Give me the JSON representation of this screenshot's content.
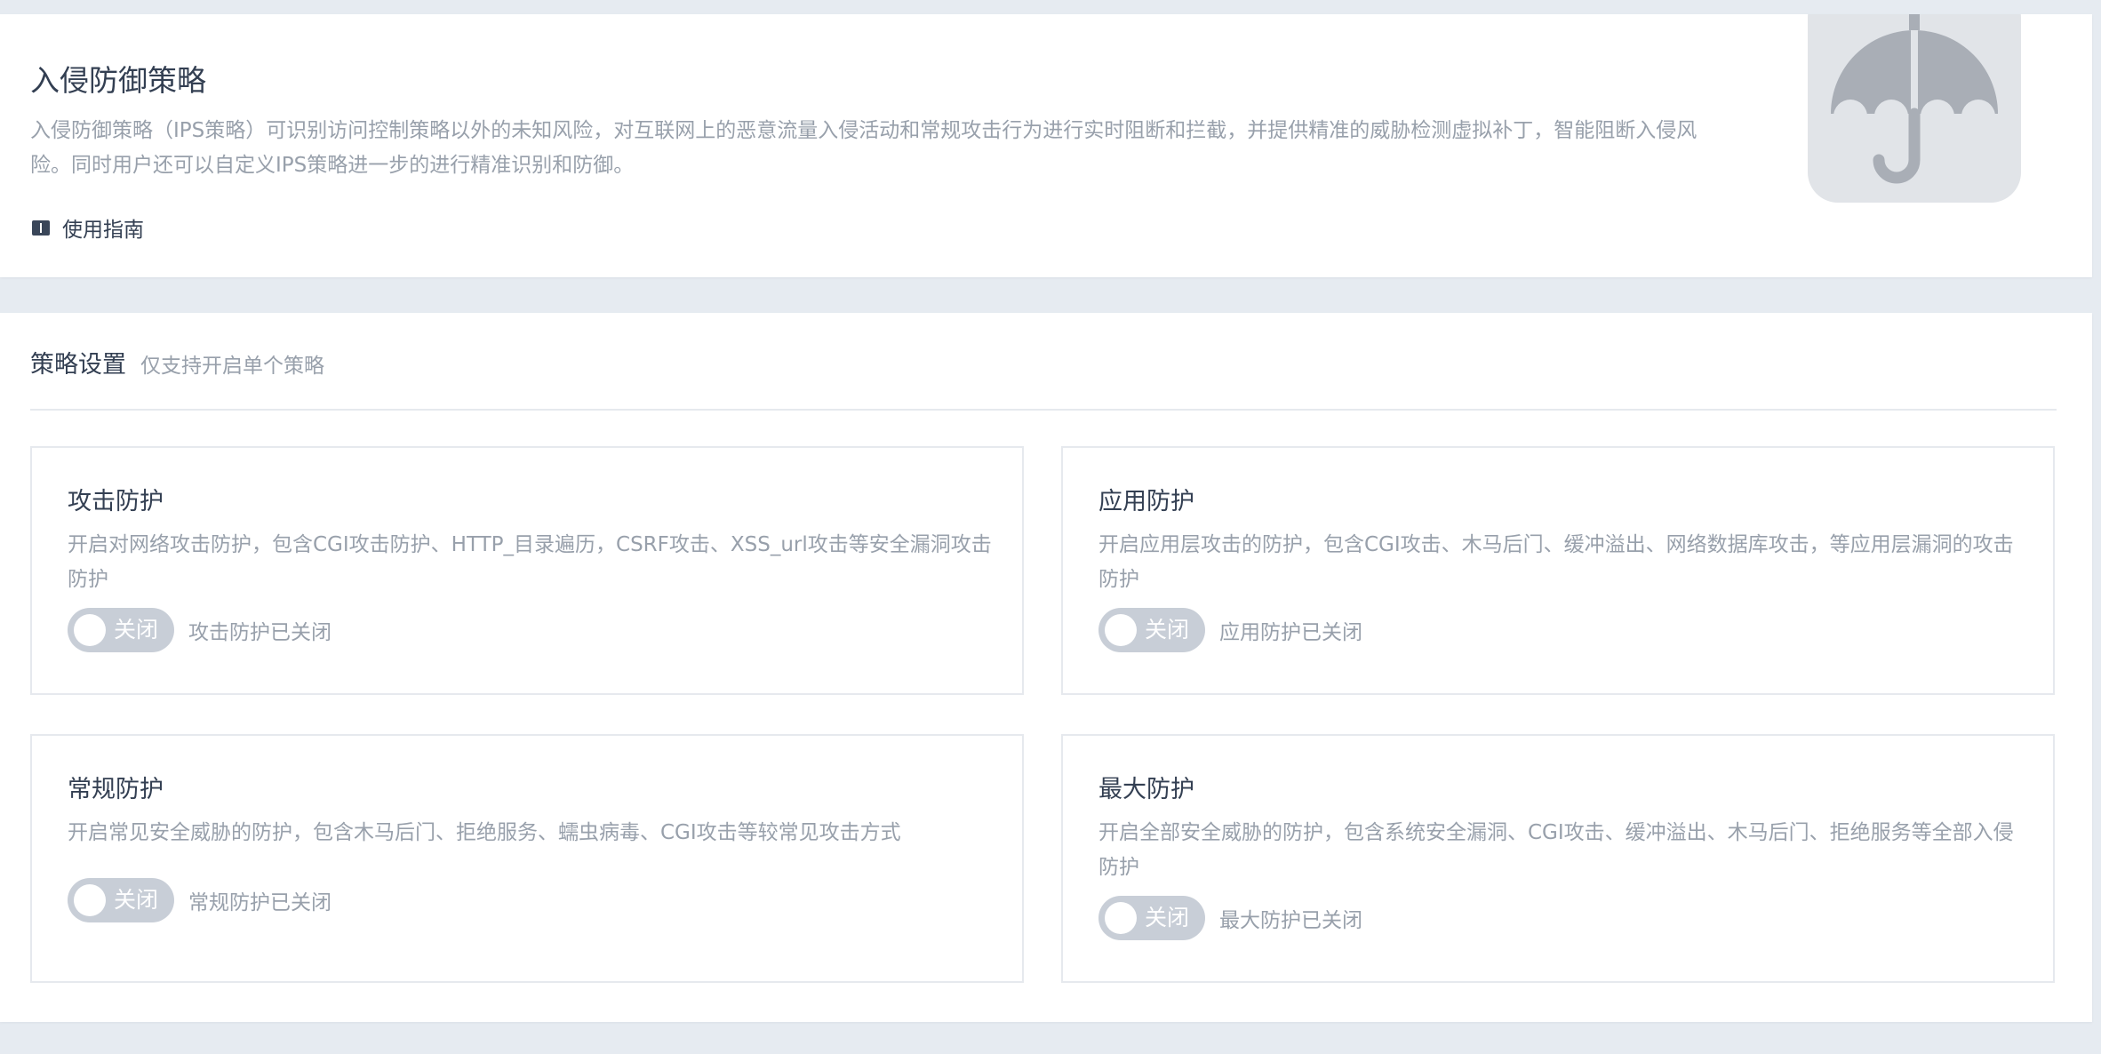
{
  "intro": {
    "title": "入侵防御策略",
    "description": "入侵防御策略（IPS策略）可识别访问控制策略以外的未知风险，对互联网上的恶意流量入侵活动和常规攻击行为进行实时阻断和拦截，并提供精准的威胁检测虚拟补丁，智能阻断入侵风险。同时用户还可以自定义IPS策略进一步的进行精准识别和防御。",
    "guide_link": "使用指南",
    "guide_icon": "book-icon",
    "illustration_icon": "umbrella-icon"
  },
  "settings": {
    "title": "策略设置",
    "hint": "仅支持开启单个策略"
  },
  "policies": [
    {
      "title": "攻击防护",
      "description": "开启对网络攻击防护，包含CGI攻击防护、HTTP_目录遍历，CSRF攻击、XSS_url攻击等安全漏洞攻击防护",
      "toggle_label": "关闭",
      "enabled": false,
      "status": "攻击防护已关闭"
    },
    {
      "title": "应用防护",
      "description": "开启应用层攻击的防护，包含CGI攻击、木马后门、缓冲溢出、网络数据库攻击，等应用层漏洞的攻击防护",
      "toggle_label": "关闭",
      "enabled": false,
      "status": "应用防护已关闭"
    },
    {
      "title": "常规防护",
      "description": "开启常见安全威胁的防护，包含木马后门、拒绝服务、蠕虫病毒、CGI攻击等较常见攻击方式",
      "toggle_label": "关闭",
      "enabled": false,
      "status": "常规防护已关闭"
    },
    {
      "title": "最大防护",
      "description": "开启全部安全威胁的防护，包含系统安全漏洞、CGI攻击、缓冲溢出、木马后门、拒绝服务等全部入侵防护",
      "toggle_label": "关闭",
      "enabled": false,
      "status": "最大防护已关闭"
    }
  ],
  "colors": {
    "page_background": "#e6ebf1",
    "card_background": "#ffffff",
    "title_text": "#333f52",
    "secondary_text": "#98a0ab",
    "toggle_off": "#c8ced7",
    "border": "#e6e9ee",
    "illustration_bg": "#e1e4e8",
    "illustration_fg": "#a9aeb6"
  }
}
